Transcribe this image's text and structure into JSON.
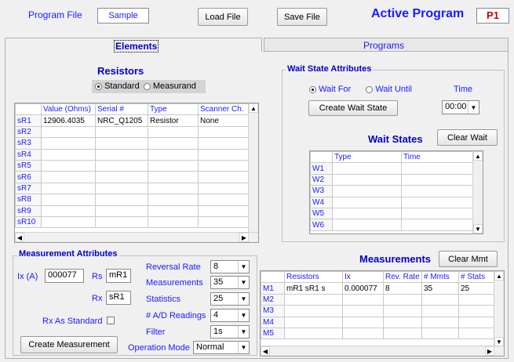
{
  "header": {
    "program_file_label": "Program File",
    "program_file_value": "Sample",
    "load_button": "Load File",
    "save_button": "Save File",
    "active_program_label": "Active Program",
    "active_program_value": "P1"
  },
  "tabs": [
    {
      "label": "Elements",
      "selected": true
    },
    {
      "label": "Programs",
      "selected": false
    }
  ],
  "resistors": {
    "title": "Resistors",
    "radio_standard": "Standard",
    "radio_measurand": "Measurand",
    "selected": "Standard",
    "columns": [
      "",
      "Value (Ohms)",
      "Serial #",
      "Type",
      "Scanner Ch."
    ],
    "rows": [
      [
        "sR1",
        "12906.4035",
        "NRC_Q1205",
        "Resistor",
        "None"
      ],
      [
        "sR2",
        "",
        "",
        "",
        ""
      ],
      [
        "sR3",
        "",
        "",
        "",
        ""
      ],
      [
        "sR4",
        "",
        "",
        "",
        ""
      ],
      [
        "sR5",
        "",
        "",
        "",
        ""
      ],
      [
        "sR6",
        "",
        "",
        "",
        ""
      ],
      [
        "sR7",
        "",
        "",
        "",
        ""
      ],
      [
        "sR8",
        "",
        "",
        "",
        ""
      ],
      [
        "sR9",
        "",
        "",
        "",
        ""
      ],
      [
        "sR10",
        "",
        "",
        "",
        ""
      ]
    ]
  },
  "wait_state": {
    "group_title": "Wait State Attributes",
    "radio_wait_for": "Wait For",
    "radio_wait_until": "Wait Until",
    "selected": "Wait For",
    "time_label": "Time",
    "create_button": "Create Wait State",
    "time_value": "00:00",
    "list_title": "Wait States",
    "clear_button": "Clear Wait",
    "columns": [
      "",
      "Type",
      "Time"
    ],
    "rows": [
      [
        "W1",
        "",
        ""
      ],
      [
        "W2",
        "",
        ""
      ],
      [
        "W3",
        "",
        ""
      ],
      [
        "W4",
        "",
        ""
      ],
      [
        "W5",
        "",
        ""
      ],
      [
        "W6",
        "",
        ""
      ]
    ]
  },
  "measurement_attributes": {
    "group_title": "Measurement Attributes",
    "ix_label": "Ix (A)",
    "ix_value": "000077",
    "rs_label": "Rs",
    "rs_value": "mR1",
    "rx_label": "Rx",
    "rx_value": "sR1",
    "rx_as_standard_label": "Rx As Standard",
    "create_button": "Create Measurement",
    "reversal_rate_label": "Reversal Rate",
    "reversal_rate_value": "8",
    "measurements_label": "Measurements",
    "measurements_value": "35",
    "statistics_label": "Statistics",
    "statistics_value": "25",
    "ad_readings_label": "# A/D Readings",
    "ad_readings_value": "4",
    "filter_label": "Filter",
    "filter_value": "1s",
    "operation_mode_label": "Operation Mode",
    "operation_mode_value": "Normal"
  },
  "measurements": {
    "title": "Measurements",
    "clear_button": "Clear Mmt",
    "columns": [
      "",
      "Resistors",
      "Ix",
      "Rev. Rate",
      "# Mmts",
      "# Stats"
    ],
    "rows": [
      [
        "M1",
        "mR1 sR1 s",
        "0.000077",
        "8",
        "35",
        "25"
      ],
      [
        "M2",
        "",
        "",
        "",
        "",
        ""
      ],
      [
        "M3",
        "",
        "",
        "",
        "",
        ""
      ],
      [
        "M4",
        "",
        "",
        "",
        "",
        ""
      ],
      [
        "M5",
        "",
        "",
        "",
        "",
        ""
      ]
    ]
  },
  "colors": {
    "accent_blue": "#1a1aff",
    "active_program_red": "#cc0000"
  }
}
